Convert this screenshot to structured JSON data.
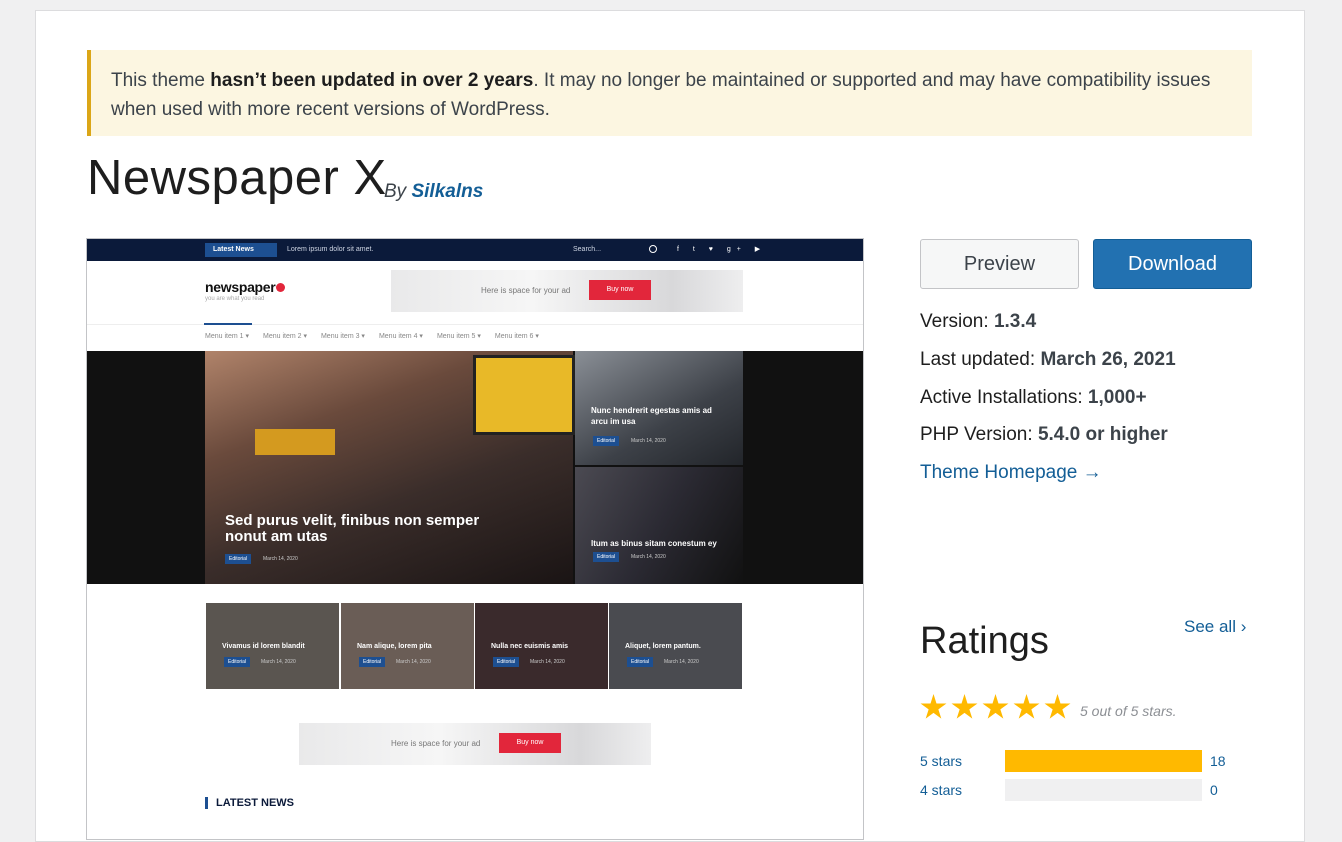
{
  "notice": {
    "pre": "This theme ",
    "bold": "hasn’t been updated in over 2 years",
    "post": ". It may no longer be maintained or supported and may have compatibility issues when used with more recent versions of WordPress."
  },
  "theme": {
    "title": "Newspaper X",
    "by": "By",
    "author": "Silkalns"
  },
  "screenshot": {
    "topbar_badge": "Latest News",
    "ticker": "Lorem ipsum dolor sit amet.",
    "search": "Search...",
    "logo": "newspaper",
    "tagline": "you are what you read",
    "ad_text": "Here is space for your ad",
    "ad_button": "Buy now",
    "menu": [
      "Menu item 1 ▾",
      "Menu item 2 ▾",
      "Menu item 3 ▾",
      "Menu item 4 ▾",
      "Menu item 5 ▾",
      "Menu item 6 ▾"
    ],
    "hero_main": {
      "title": "Sed purus velit, finibus non semper nonut am utas",
      "chip": "Editorial",
      "date": "March 14, 2020"
    },
    "hero_side1": {
      "title": "Nunc hendrerit egestas amis ad arcu im usa",
      "chip": "Editorial",
      "date": "March 14, 2020"
    },
    "hero_side2": {
      "title": "Itum as binus sitam conestum ey",
      "chip": "Editorial",
      "date": "March 14, 2020"
    },
    "thumbs": [
      {
        "title": "Vivamus id lorem blandit",
        "chip": "Editorial",
        "date": "March 14, 2020",
        "color": "#5a5550"
      },
      {
        "title": "Nam alique, lorem pita",
        "chip": "Editorial",
        "date": "March 14, 2020",
        "color": "#6a5d56"
      },
      {
        "title": "Nulla nec euismis amis",
        "chip": "Editorial",
        "date": "March 14, 2020",
        "color": "#3a2a2c"
      },
      {
        "title": "Aliquet, lorem pantum.",
        "chip": "Editorial",
        "date": "March 14, 2020",
        "color": "#4a4b50"
      }
    ],
    "latest_news": "LATEST NEWS"
  },
  "actions": {
    "preview": "Preview",
    "download": "Download"
  },
  "meta": {
    "version_label": "Version:",
    "version": "1.3.4",
    "updated_label": "Last updated:",
    "updated": "March 26, 2021",
    "installs_label": "Active Installations:",
    "installs": "1,000+",
    "php_label": "PHP Version:",
    "php": "5.4.0 or higher",
    "homepage": "Theme Homepage →"
  },
  "ratings": {
    "heading": "Ratings",
    "see_all": "See all ›",
    "summary": "5 out of 5 stars.",
    "stars": 5,
    "rows": [
      {
        "label": "5 stars",
        "count": "18",
        "fraction": 1.0
      },
      {
        "label": "4 stars",
        "count": "0",
        "fraction": 0.0
      }
    ]
  },
  "colors": {
    "accent": "#2271b1",
    "link": "#135e96",
    "star": "#ffb900",
    "notice_border": "#dba617"
  }
}
